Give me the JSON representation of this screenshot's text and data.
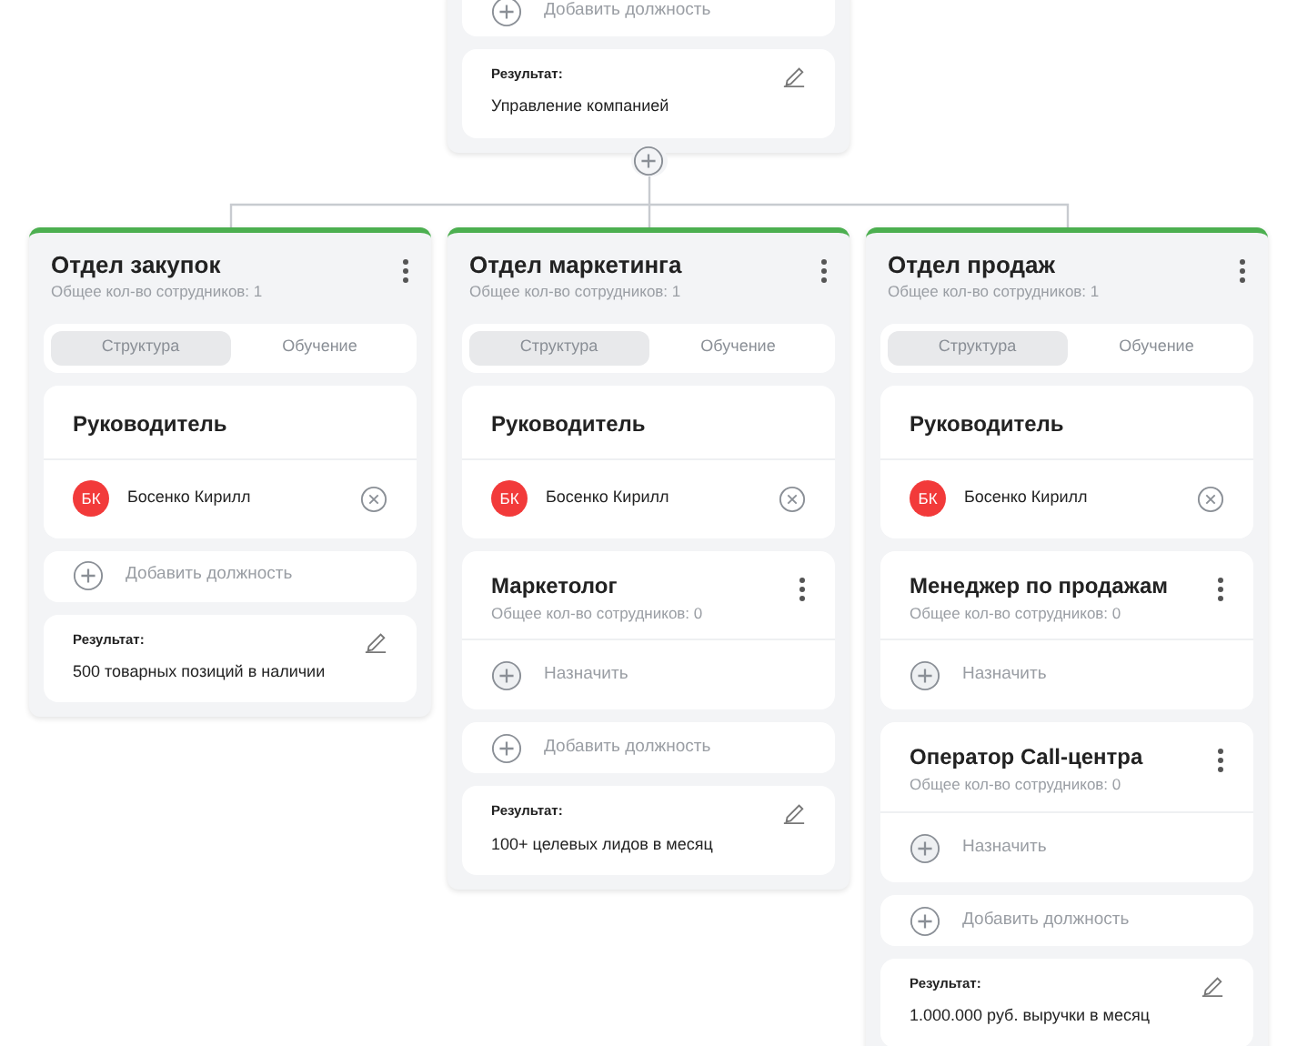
{
  "top_card": {
    "add_label": "Добавить должность",
    "result": {
      "label": "Результат:",
      "value": "Управление компанией"
    }
  },
  "departments": [
    {
      "name": "Отдел закупок",
      "count": "Общее кол-во сотрудников: 1",
      "tabs": [
        {
          "label": "Структура",
          "selected": true
        },
        {
          "label": "Обучение",
          "selected": false
        }
      ],
      "leader": {
        "title": "Руководитель",
        "initials": "БК",
        "name": "Босенко Кирилл",
        "color": "#f23a3a"
      },
      "add_label": "Добавить должность",
      "result": {
        "label": "Результат:",
        "value": "500 товарных позиций в наличии"
      }
    },
    {
      "name": "Отдел маркетинга",
      "count": "Общее кол-во сотрудников: 1",
      "tabs": [
        {
          "label": "Структура",
          "selected": true
        },
        {
          "label": "Обучение",
          "selected": false
        }
      ],
      "leader": {
        "title": "Руководитель",
        "initials": "БК",
        "name": "Босенко Кирилл",
        "color": "#f23a3a"
      },
      "positions": [
        {
          "title": "Маркетолог",
          "count": "Общее кол-во сотрудников: 0",
          "assign": "Назначить"
        }
      ],
      "add_label": "Добавить должность",
      "result": {
        "label": "Результат:",
        "value": "100+ целевых лидов в месяц"
      }
    },
    {
      "name": "Отдел продаж",
      "count": "Общее кол-во сотрудников: 1",
      "tabs": [
        {
          "label": "Структура",
          "selected": true
        },
        {
          "label": "Обучение",
          "selected": false
        }
      ],
      "leader": {
        "title": "Руководитель",
        "initials": "БК",
        "name": "Босенко Кирилл",
        "color": "#f23a3a"
      },
      "positions": [
        {
          "title": "Менеджер по продажам",
          "count": "Общее кол-во сотрудников: 0",
          "assign": "Назначить"
        },
        {
          "title": "Оператор Call-центра",
          "count": "Общее кол-во сотрудников: 0",
          "assign": "Назначить"
        }
      ],
      "add_label": "Добавить должность",
      "result": {
        "label": "Результат:",
        "value": "1.000.000 руб. выручки в месяц"
      }
    }
  ]
}
